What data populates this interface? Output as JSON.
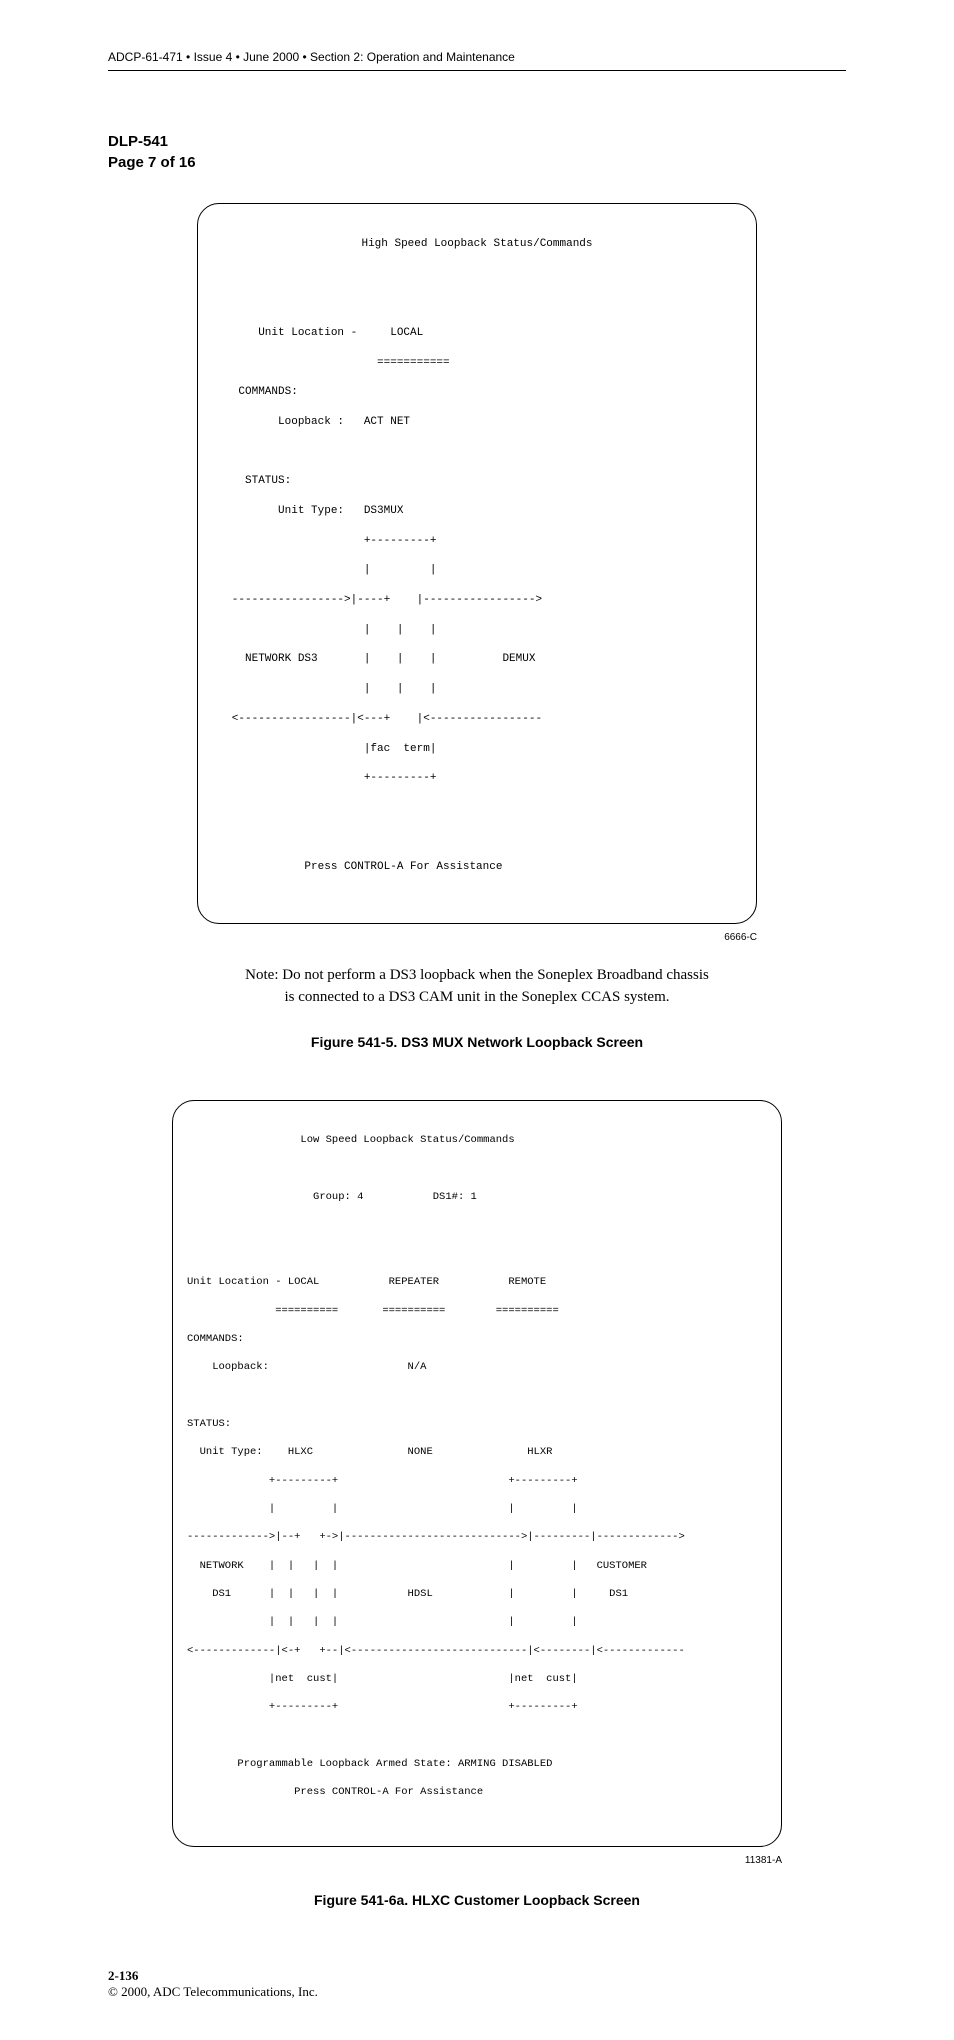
{
  "header": {
    "running": "ADCP-61-471 • Issue 4 • June 2000 • Section 2: Operation and Maintenance"
  },
  "dlp": {
    "code": "DLP-541",
    "page": "Page 7 of 16"
  },
  "fig1": {
    "title": "High Speed Loopback Status/Commands",
    "line_unit_loc": "       Unit Location -     LOCAL",
    "line_uline": "                         ===========",
    "line_cmds": "    COMMANDS:",
    "line_loop": "          Loopback :   ACT NET",
    "line_status": "     STATUS:",
    "line_unit_type": "          Unit Type:   DS3MUX",
    "line_boxtop": "                       +---------+",
    "line_bars1": "                       |         |",
    "line_arrows1": "   ----------------->|----+    |----------------->",
    "line_bars2": "                       |    |    |",
    "line_net": "     NETWORK DS3       |    |    |          DEMUX",
    "line_bars3": "                       |    |    |",
    "line_arrows2": "   <-----------------|<---+    |<-----------------",
    "line_fac": "                       |fac  term|",
    "line_boxbot": "                       +---------+",
    "line_assist": "              Press CONTROL-A For Assistance",
    "id": "6666-C"
  },
  "note": {
    "l1": "Note: Do not perform a DS3 loopback when the Soneplex Broadband chassis",
    "l2": "is connected to a DS3 CAM unit in the Soneplex CCAS system."
  },
  "caption1": "Figure 541-5. DS3 MUX Network Loopback Screen",
  "fig2": {
    "title": "                  Low Speed Loopback Status/Commands",
    "grp": "                    Group: 4           DS1#: 1",
    "loc": "Unit Location - LOCAL           REPEATER           REMOTE",
    "uline": "              ==========       ==========        ==========",
    "cmds": "COMMANDS:",
    "loop": "    Loopback:                      N/A",
    "status": "STATUS:",
    "utype": "  Unit Type:    HLXC               NONE               HLXR",
    "boxtop": "             +---------+                           +---------+",
    "bars1": "             |         |                           |         |",
    "arr1": "------------->|--+   +->|---------------------------->|---------|------------->",
    "mid1": "  NETWORK    |  |   |  |                           |         |   CUSTOMER",
    "mid2": "    DS1      |  |   |  |           HDSL            |         |     DS1",
    "bars2": "             |  |   |  |                           |         |",
    "arr2": "<-------------|<-+   +--|<----------------------------|<--------|<-------------",
    "netcust": "             |net  cust|                           |net  cust|",
    "boxbot": "             +---------+                           +---------+",
    "armed": "        Programmable Loopback Armed State: ARMING DISABLED",
    "assist": "                 Press CONTROL-A For Assistance",
    "id": "11381-A"
  },
  "caption2": "Figure 541-6a. HLXC Customer Loopback Screen",
  "footer": {
    "pagenum": "2-136",
    "copyright": "© 2000, ADC Telecommunications, Inc."
  }
}
